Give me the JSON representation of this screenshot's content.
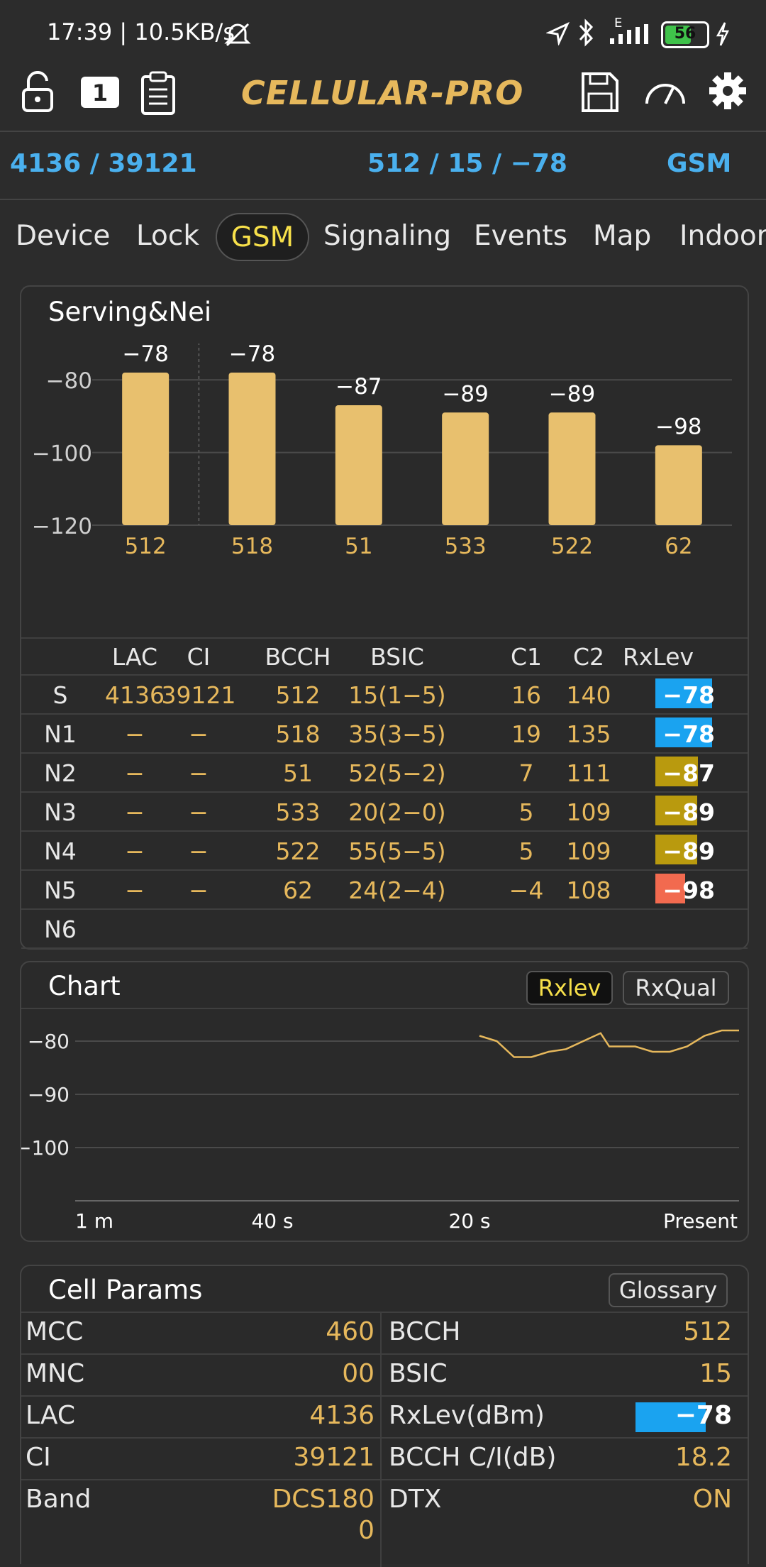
{
  "status_bar": {
    "time_speed": "17:39 | 10.5KB/s",
    "battery": "56",
    "network_letter": "E"
  },
  "toolbar": {
    "brand": "CELLULAR-PRO",
    "sim_label": "1"
  },
  "info_row": {
    "lac_ci": "4136 / 39121",
    "bcch_bsic_rx": "512 / 15 / −78",
    "tech": "GSM"
  },
  "tabs": [
    {
      "label": "Device"
    },
    {
      "label": "Lock"
    },
    {
      "label": "GSM",
      "active": true
    },
    {
      "label": "Signaling"
    },
    {
      "label": "Events"
    },
    {
      "label": "Map"
    },
    {
      "label": "Indoor"
    }
  ],
  "serving_nei": {
    "title": "Serving&Nei",
    "chart_data": {
      "type": "bar",
      "categories": [
        "512",
        "518",
        "51",
        "533",
        "522",
        "62"
      ],
      "values": [
        -78,
        -78,
        -87,
        -89,
        -89,
        -98
      ],
      "value_labels": [
        "−78",
        "−78",
        "−87",
        "−89",
        "−89",
        "−98"
      ],
      "yticks": [
        -80,
        -100,
        -120
      ],
      "ytick_labels": [
        "−80",
        "−100",
        "−120"
      ],
      "ylim": [
        -120,
        -70
      ],
      "bar_color": "#e8c06e",
      "grid": true
    },
    "table": {
      "headers": [
        "LAC",
        "CI",
        "BCCH",
        "BSIC",
        "C1",
        "C2",
        "RxLev"
      ],
      "rows": [
        {
          "label": "S",
          "lac": "4136",
          "ci": "39121",
          "bcch": "512",
          "bsic": "15(1−5)",
          "c1": "16",
          "c2": "140",
          "rxlev": "−78",
          "rx_fraction": 0.95,
          "rx_color": "#1aa3f0"
        },
        {
          "label": "N1",
          "lac": "−",
          "ci": "−",
          "bcch": "518",
          "bsic": "35(3−5)",
          "c1": "19",
          "c2": "135",
          "rxlev": "−78",
          "rx_fraction": 0.95,
          "rx_color": "#1aa3f0"
        },
        {
          "label": "N2",
          "lac": "−",
          "ci": "−",
          "bcch": "51",
          "bsic": "52(5−2)",
          "c1": "7",
          "c2": "111",
          "rxlev": "−87",
          "rx_fraction": 0.72,
          "rx_color": "#b99a0e"
        },
        {
          "label": "N3",
          "lac": "−",
          "ci": "−",
          "bcch": "533",
          "bsic": "20(2−0)",
          "c1": "5",
          "c2": "109",
          "rxlev": "−89",
          "rx_fraction": 0.7,
          "rx_color": "#b99a0e"
        },
        {
          "label": "N4",
          "lac": "−",
          "ci": "−",
          "bcch": "522",
          "bsic": "55(5−5)",
          "c1": "5",
          "c2": "109",
          "rxlev": "−89",
          "rx_fraction": 0.7,
          "rx_color": "#b99a0e"
        },
        {
          "label": "N5",
          "lac": "−",
          "ci": "−",
          "bcch": "62",
          "bsic": "24(2−4)",
          "c1": "−4",
          "c2": "108",
          "rxlev": "−98",
          "rx_fraction": 0.5,
          "rx_color": "#f26a4f"
        },
        {
          "label": "N6",
          "lac": "",
          "ci": "",
          "bcch": "",
          "bsic": "",
          "c1": "",
          "c2": "",
          "rxlev": "",
          "rx_fraction": 0,
          "rx_color": "#1aa3f0"
        }
      ]
    }
  },
  "chart_card": {
    "title": "Chart",
    "btn_rxlev": "Rxlev",
    "btn_rxqual": "RxQual",
    "chart_data": {
      "type": "line",
      "ytick_labels": [
        "−80",
        "−90",
        "−100"
      ],
      "yticks": [
        -80,
        -90,
        -100
      ],
      "ylim": [
        -110,
        -74
      ],
      "xtick_labels": [
        "1 m",
        "40 s",
        "20 s",
        "Present"
      ],
      "x_seconds": [
        -30,
        -28,
        -26,
        -24,
        -22,
        -20,
        -18,
        -16,
        -15,
        -14,
        -12,
        -10,
        -8,
        -6,
        -4,
        -2,
        0
      ],
      "series": [
        {
          "values": [
            -79,
            -80,
            -83,
            -83,
            -82,
            -81.5,
            -80,
            -78.5,
            -81,
            -81,
            -81,
            -82,
            -82,
            -81,
            -79,
            -78,
            -78
          ],
          "color": "#e6b85c"
        }
      ],
      "grid": true
    }
  },
  "cell_params": {
    "title": "Cell Params",
    "glossary_label": "Glossary",
    "left": [
      {
        "label": "MCC",
        "value": "460"
      },
      {
        "label": "MNC",
        "value": "00"
      },
      {
        "label": "LAC",
        "value": "4136"
      },
      {
        "label": "CI",
        "value": "39121"
      },
      {
        "label": "Band",
        "value_line1": "DCS180",
        "value_line2": "0"
      }
    ],
    "right": [
      {
        "label": "BCCH",
        "value": "512"
      },
      {
        "label": "BSIC",
        "value": "15"
      },
      {
        "label": "RxLev(dBm)",
        "value": "−78",
        "rx_fraction": 0.75,
        "rx_color": "#1aa3f0"
      },
      {
        "label": "BCCH C/I(dB)",
        "value": "18.2"
      },
      {
        "label": "DTX",
        "value": "ON"
      }
    ]
  }
}
